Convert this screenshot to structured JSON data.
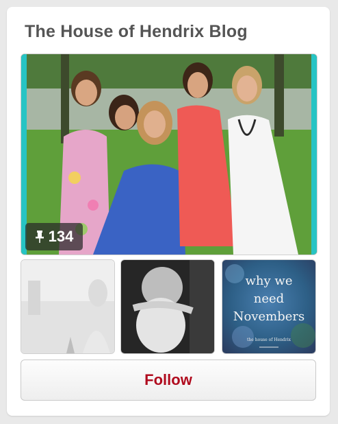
{
  "board": {
    "title": "The House of Hendrix Blog",
    "pin_count": "134",
    "thumbnails": [
      {
        "overlay_lines": []
      },
      {
        "overlay_lines": []
      },
      {
        "overlay_lines": [
          "why we",
          "need",
          "Novembers"
        ],
        "caption": "the house of Hendrix"
      }
    ],
    "follow_label": "Follow"
  },
  "colors": {
    "follow_text": "#b00b1e",
    "title_text": "#555555",
    "frame_accent": "#27c4c4"
  },
  "icons": {
    "pin": "pushpin-icon"
  }
}
